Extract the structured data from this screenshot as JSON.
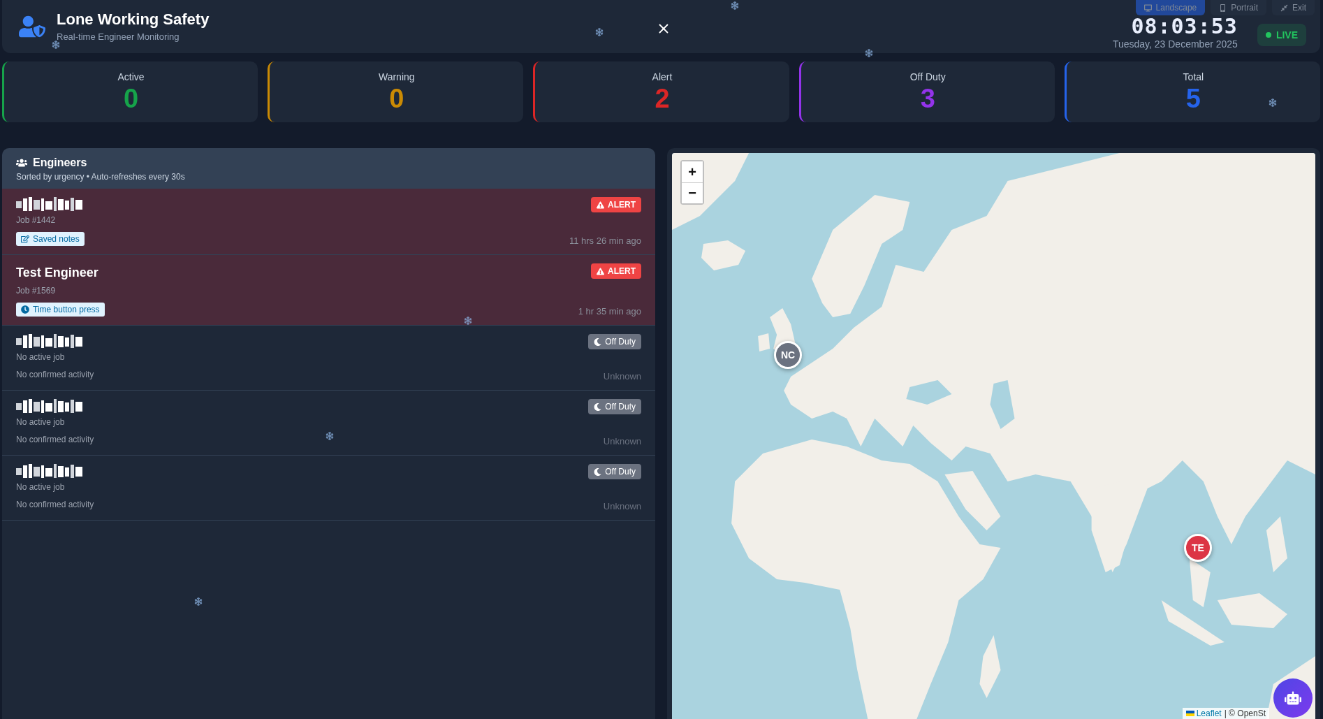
{
  "header": {
    "title": "Lone Working Safety",
    "subtitle": "Real-time Engineer Monitoring",
    "display_modes": [
      {
        "label": "Landscape",
        "selected": true
      },
      {
        "label": "Portrait",
        "selected": false
      }
    ],
    "exit": "Exit",
    "clock": "08:03:53",
    "date": "Tuesday, 23 December 2025",
    "live": "LIVE"
  },
  "stats": [
    {
      "label": "Active",
      "value": "0",
      "color": "#16a34a"
    },
    {
      "label": "Warning",
      "value": "0",
      "color": "#ca8a04"
    },
    {
      "label": "Alert",
      "value": "2",
      "color": "#dc2626"
    },
    {
      "label": "Off Duty",
      "value": "3",
      "color": "#9333ea"
    },
    {
      "label": "Total",
      "value": "5",
      "color": "#2563eb"
    }
  ],
  "engineers_panel": {
    "title": "Engineers",
    "subtitle": "Sorted by urgency • Auto-refreshes every 30s",
    "rows": [
      {
        "name_redacted": true,
        "job": "Job #1442",
        "tag": {
          "kind": "notes",
          "text": "Saved notes"
        },
        "status": {
          "kind": "alert",
          "label": "ALERT"
        },
        "time": "11 hrs 26 min ago"
      },
      {
        "name_redacted": false,
        "name": "Test Engineer",
        "job": "Job #1569",
        "tag": {
          "kind": "clock",
          "text": "Time button press"
        },
        "status": {
          "kind": "alert",
          "label": "ALERT"
        },
        "time": "1 hr 35 min ago"
      },
      {
        "name_redacted": true,
        "job": "No active job",
        "activity": "No confirmed activity",
        "status": {
          "kind": "off_duty",
          "label": "Off Duty"
        },
        "time": "Unknown"
      },
      {
        "name_redacted": true,
        "job": "No active job",
        "activity": "No confirmed activity",
        "status": {
          "kind": "off_duty",
          "label": "Off Duty"
        },
        "time": "Unknown"
      },
      {
        "name_redacted": true,
        "job": "No active job",
        "activity": "No confirmed activity",
        "status": {
          "kind": "off_duty",
          "label": "Off Duty"
        },
        "time": "Unknown"
      }
    ]
  },
  "map": {
    "zoom_in": "+",
    "zoom_out": "−",
    "markers": [
      {
        "initials": "NC",
        "color": "#6b7280"
      },
      {
        "initials": "TE",
        "color": "#dc3545"
      }
    ],
    "attribution_link": "Leaflet",
    "attribution": "| © OpenSt"
  }
}
